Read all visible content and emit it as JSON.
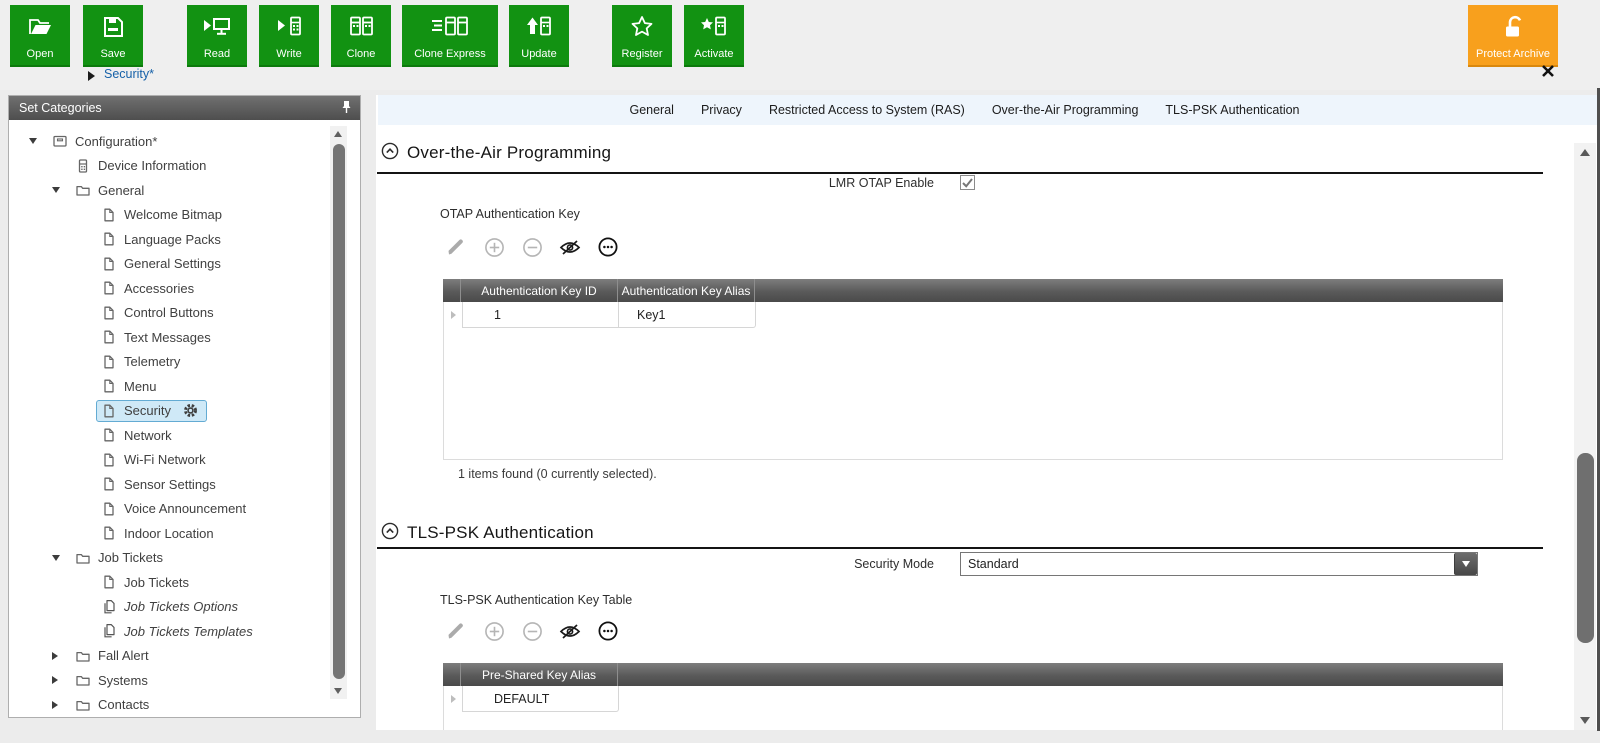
{
  "toolbar": {
    "buttons": [
      {
        "label": "Open"
      },
      {
        "label": "Save"
      },
      {
        "label": "Read"
      },
      {
        "label": "Write"
      },
      {
        "label": "Clone"
      },
      {
        "label": "Clone Express"
      },
      {
        "label": "Update"
      },
      {
        "label": "Register"
      },
      {
        "label": "Activate"
      },
      {
        "label": "Protect Archive"
      }
    ],
    "accent_green": "#129212",
    "accent_orange": "#f8a01d"
  },
  "tab_row": {
    "active_tab": "Security*"
  },
  "sidebar": {
    "title": "Set Categories",
    "tree": [
      {
        "label": "Configuration*"
      },
      {
        "label": "Device Information"
      },
      {
        "label": "General"
      },
      {
        "label": "Welcome Bitmap"
      },
      {
        "label": "Language Packs"
      },
      {
        "label": "General Settings"
      },
      {
        "label": "Accessories"
      },
      {
        "label": "Control Buttons"
      },
      {
        "label": "Text Messages"
      },
      {
        "label": "Telemetry"
      },
      {
        "label": "Menu"
      },
      {
        "label": "Security"
      },
      {
        "label": "Network"
      },
      {
        "label": "Wi-Fi Network"
      },
      {
        "label": "Sensor Settings"
      },
      {
        "label": "Voice Announcement"
      },
      {
        "label": "Indoor Location"
      },
      {
        "label": "Job Tickets"
      },
      {
        "label": "Job Tickets"
      },
      {
        "label": "Job Tickets Options"
      },
      {
        "label": "Job Tickets Templates"
      },
      {
        "label": "Fall Alert"
      },
      {
        "label": "Systems"
      },
      {
        "label": "Contacts"
      }
    ],
    "selected_item": "Security"
  },
  "main": {
    "nav_tabs": [
      {
        "label": "General"
      },
      {
        "label": "Privacy"
      },
      {
        "label": "Restricted Access to System (RAS)"
      },
      {
        "label": "Over-the-Air Programming"
      },
      {
        "label": "TLS-PSK Authentication"
      }
    ],
    "otap": {
      "title": "Over-the-Air Programming",
      "lmr_otap_label": "LMR OTAP Enable",
      "lmr_otap_checked": true,
      "key_table_label": "OTAP Authentication Key",
      "table": {
        "columns": [
          "Authentication Key ID",
          "Authentication Key Alias"
        ],
        "rows": [
          [
            "1",
            "Key1"
          ]
        ]
      },
      "status": "1 items found (0 currently selected)."
    },
    "tls": {
      "title": "TLS-PSK Authentication",
      "security_mode_label": "Security Mode",
      "security_mode_value": "Standard",
      "key_table_label": "TLS-PSK Authentication Key Table",
      "table": {
        "columns": [
          "Pre-Shared Key Alias"
        ],
        "rows": [
          [
            "DEFAULT"
          ]
        ]
      }
    }
  }
}
